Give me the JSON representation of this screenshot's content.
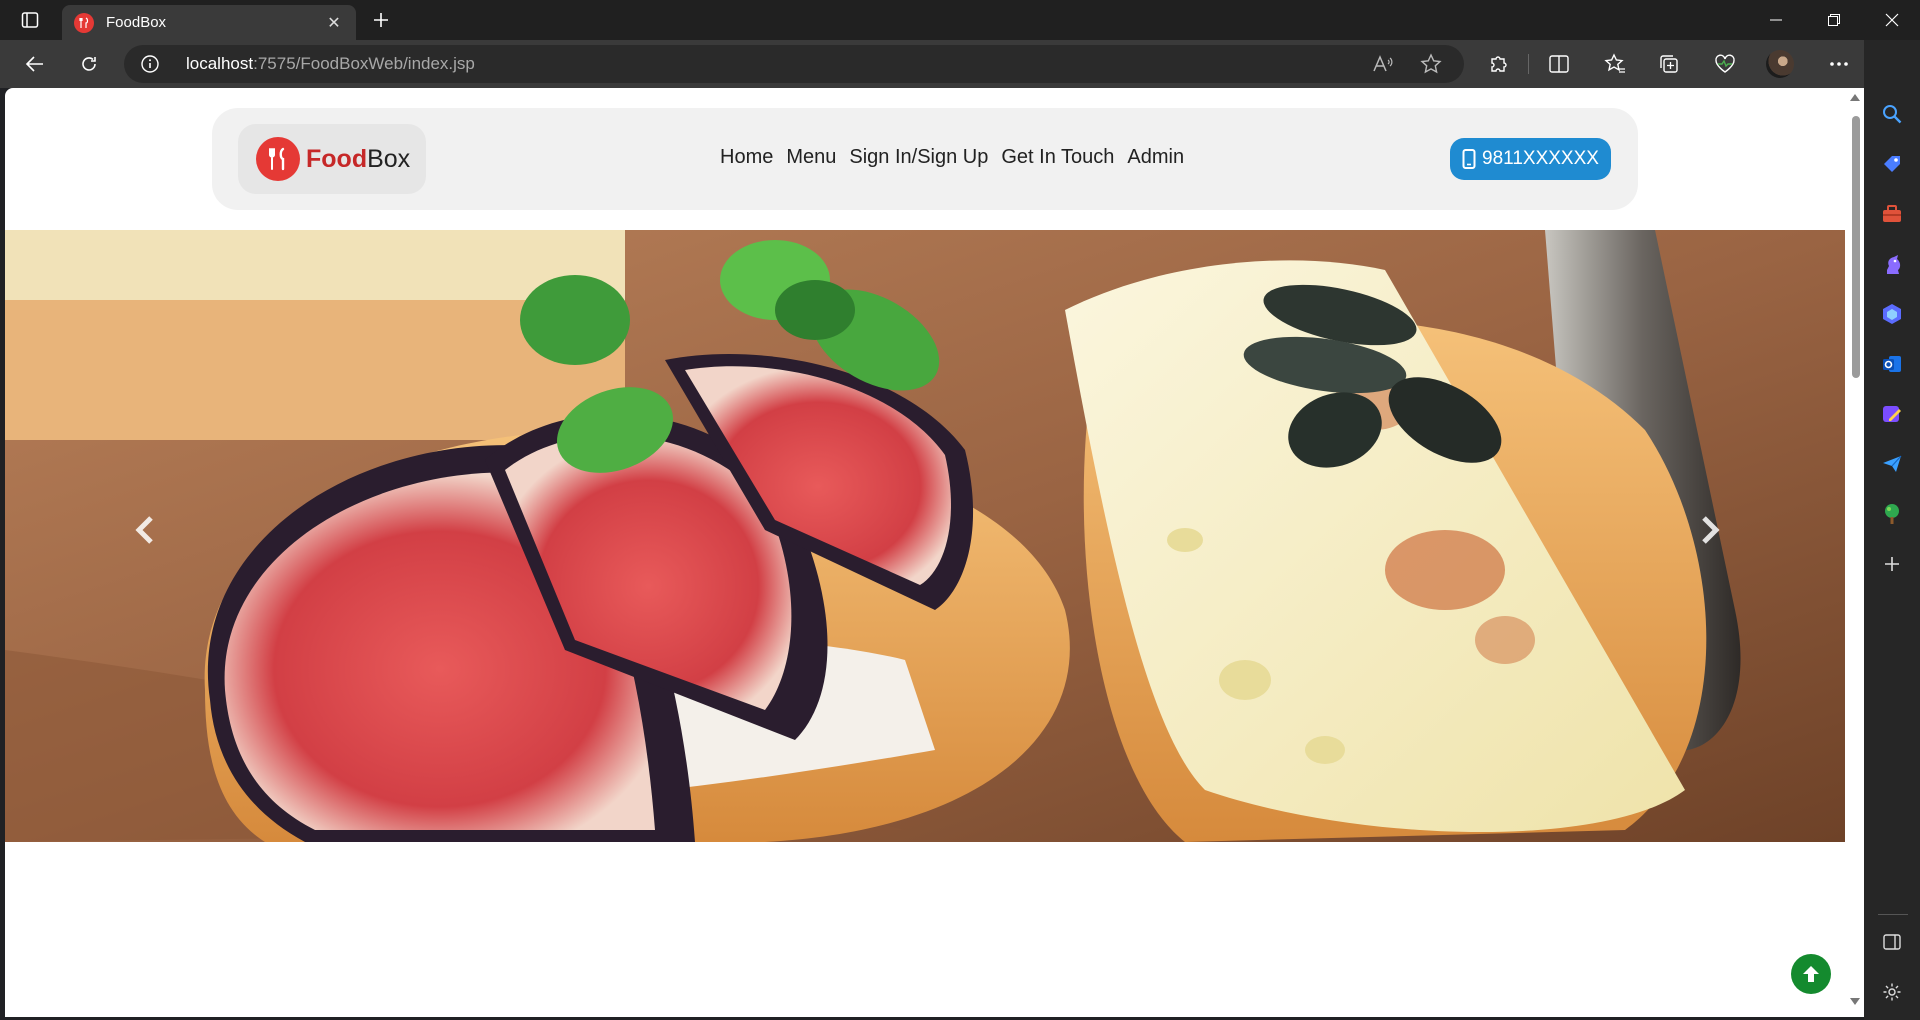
{
  "browser": {
    "tab_title": "FoodBox",
    "url_host": "localhost",
    "url_rest": ":7575/FoodBoxWeb/index.jsp"
  },
  "site": {
    "brand_primary": "Food",
    "brand_secondary": "Box",
    "nav": [
      "Home",
      "Menu",
      "Sign In/Sign Up",
      "Get In Touch",
      "Admin"
    ],
    "phone": "9811XXXXXX",
    "colors": {
      "brand_red": "#c62828",
      "phone_blue": "#1f8bd1",
      "scroll_top_green": "#148a2e"
    }
  },
  "carousel": {
    "prev_icon": "chevron-left-icon",
    "next_icon": "chevron-right-icon"
  }
}
